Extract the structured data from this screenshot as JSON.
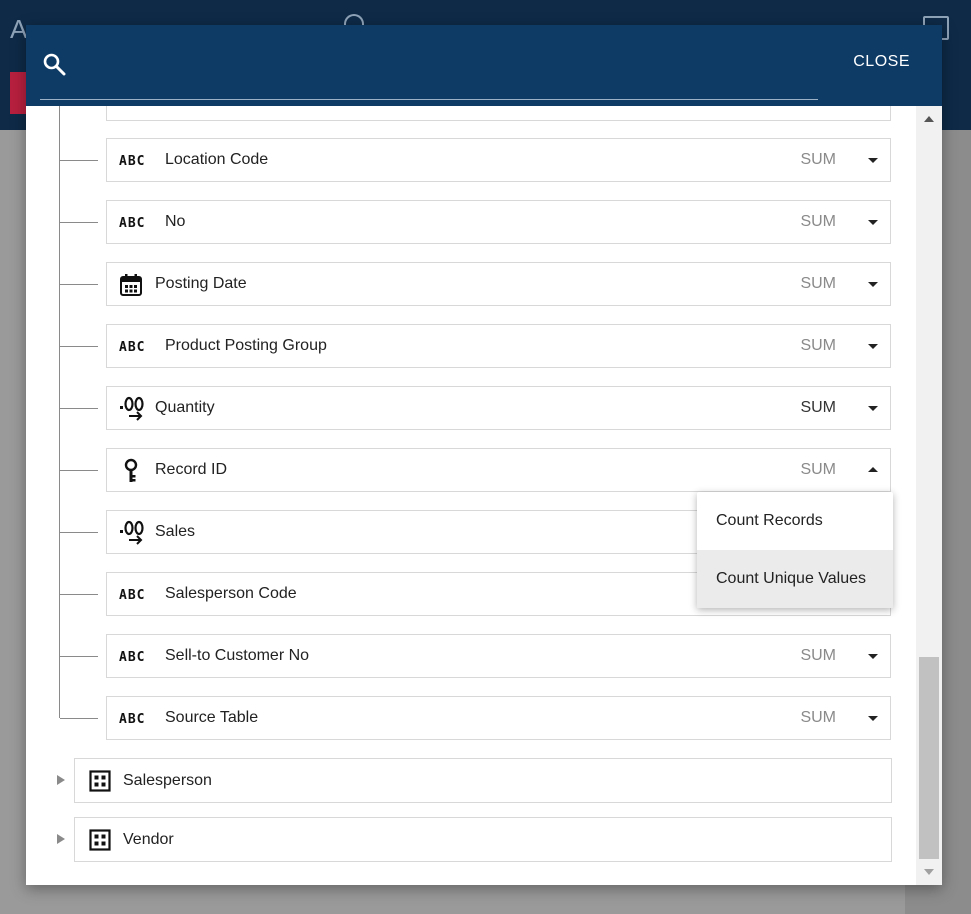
{
  "background": {
    "app_title": "A"
  },
  "dialog": {
    "search": {
      "placeholder": "",
      "value": ""
    },
    "close_label": "CLOSE"
  },
  "fields": [
    {
      "name": "Location Code",
      "type": "text",
      "aggregation": "SUM"
    },
    {
      "name": "No",
      "type": "text",
      "aggregation": "SUM"
    },
    {
      "name": "Posting Date",
      "type": "date",
      "aggregation": "SUM"
    },
    {
      "name": "Product Posting Group",
      "type": "text",
      "aggregation": "SUM"
    },
    {
      "name": "Quantity",
      "type": "number",
      "aggregation": "SUM"
    },
    {
      "name": "Record ID",
      "type": "key",
      "aggregation": "SUM"
    },
    {
      "name": "Sales",
      "type": "number",
      "aggregation": ""
    },
    {
      "name": "Salesperson Code",
      "type": "text",
      "aggregation": ""
    },
    {
      "name": "Sell-to Customer No",
      "type": "text",
      "aggregation": "SUM"
    },
    {
      "name": "Source Table",
      "type": "text",
      "aggregation": "SUM"
    }
  ],
  "groups": [
    {
      "name": "Salesperson"
    },
    {
      "name": "Vendor"
    }
  ],
  "aggregation_menu": {
    "items": [
      "Count Records",
      "Count Unique Values"
    ],
    "highlighted": "Count Unique Values"
  },
  "icons": {
    "text": "abc-icon",
    "date": "calendar-icon",
    "number": "decimal-number-icon",
    "key": "key-icon",
    "group": "table-grid-icon"
  },
  "colors": {
    "header": "#0e3b66",
    "app_header": "#0e2a47",
    "accent_red": "#b8203f"
  },
  "abc_glyph": "ABC"
}
